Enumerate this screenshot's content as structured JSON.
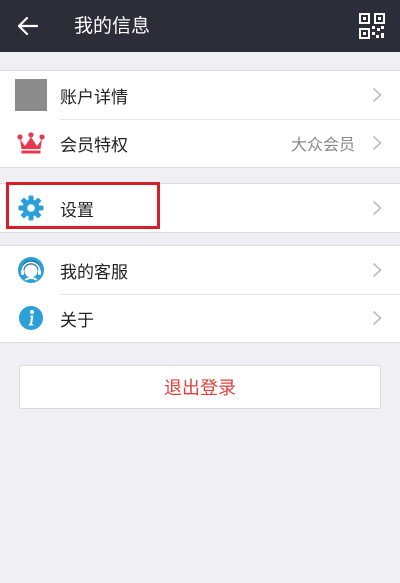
{
  "header": {
    "title": "我的信息",
    "back_icon": "arrow-left-icon",
    "qr_icon": "qr-code-icon"
  },
  "groups": [
    {
      "items": [
        {
          "label": "账户详情",
          "icon": "avatar-placeholder-icon",
          "value": ""
        },
        {
          "label": "会员特权",
          "icon": "crown-icon",
          "value": "大众会员"
        }
      ]
    },
    {
      "items": [
        {
          "label": "设置",
          "icon": "gear-icon",
          "value": ""
        }
      ]
    },
    {
      "items": [
        {
          "label": "我的客服",
          "icon": "customer-service-icon",
          "value": ""
        },
        {
          "label": "关于",
          "icon": "info-icon",
          "value": ""
        }
      ]
    }
  ],
  "logout_label": "退出登录",
  "colors": {
    "header_bg": "#2b2d38",
    "page_bg": "#efeff4",
    "accent_blue": "#2a9fd8",
    "crown_red": "#e8384f",
    "logout_text": "#e0413a",
    "highlight_border": "#d41e2a"
  }
}
